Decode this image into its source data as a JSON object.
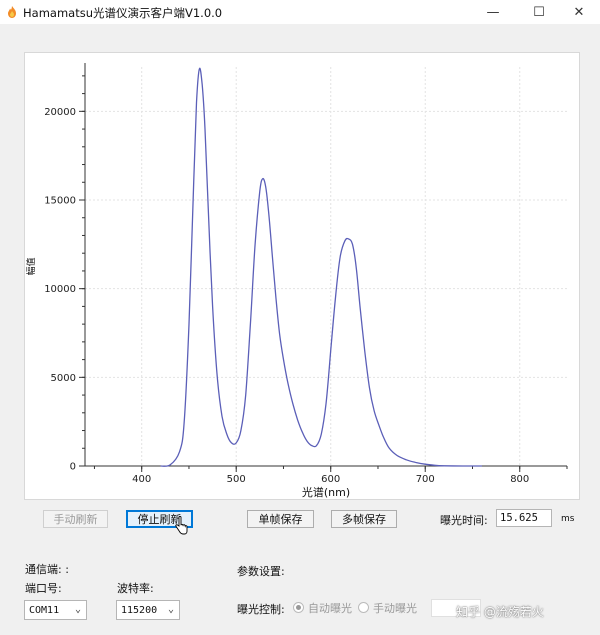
{
  "window": {
    "title": "Hamamatsu光谱仪演示客户端V1.0.0",
    "minimize_glyph": "—",
    "maximize_glyph": "☐",
    "close_glyph": "✕"
  },
  "chart_data": {
    "type": "line",
    "title": "",
    "xlabel": "光谱(nm)",
    "ylabel": "幅值",
    "xlim": [
      340,
      850
    ],
    "ylim": [
      0,
      22500
    ],
    "xticks": [
      400,
      500,
      600,
      700,
      800
    ],
    "yticks": [
      0,
      5000,
      10000,
      15000,
      20000
    ],
    "grid": true,
    "line_color": "#5b5fb8",
    "series": [
      {
        "x": [
          420,
          430,
          440,
          445,
          450,
          455,
          458,
          461,
          464,
          467,
          470,
          475,
          480,
          485,
          490,
          495,
          500,
          505,
          510,
          515,
          520,
          525,
          528,
          531,
          534,
          538,
          542,
          546,
          550,
          555,
          560,
          565,
          570,
          575,
          580,
          585,
          590,
          595,
          600,
          605,
          610,
          615,
          619,
          623,
          627,
          631,
          636,
          641,
          646,
          651,
          656,
          662,
          670,
          680,
          690,
          700,
          710,
          720,
          740,
          760
        ],
        "y": [
          0,
          60,
          800,
          2500,
          8000,
          16000,
          20500,
          22400,
          21500,
          19000,
          15000,
          9000,
          5000,
          2800,
          1800,
          1300,
          1300,
          2000,
          4000,
          8000,
          12500,
          15500,
          16200,
          15800,
          14500,
          12000,
          9500,
          7400,
          6000,
          4600,
          3500,
          2600,
          1900,
          1400,
          1150,
          1150,
          1800,
          3500,
          6500,
          9500,
          11800,
          12700,
          12800,
          12500,
          11200,
          9000,
          6500,
          4400,
          3100,
          2300,
          1600,
          1000,
          600,
          350,
          200,
          100,
          40,
          10,
          0,
          0
        ]
      }
    ]
  },
  "controls": {
    "manual_refresh_label": "手动刷新",
    "stop_refresh_label": "停止刷新",
    "single_frame_save_label": "单帧保存",
    "multi_frame_save_label": "多帧保存",
    "exposure_time_label": "曝光时间:",
    "exposure_time_value": "15.625",
    "exposure_time_unit": "ms"
  },
  "communication": {
    "status_label": "通信端: :",
    "port_label": "端口号:",
    "port_value": "COM11",
    "baud_label": "波特率:",
    "baud_value": "115200"
  },
  "parameters": {
    "section_label": "参数设置:",
    "exposure_control_label": "曝光控制:",
    "auto_exposure_label": "自动曝光",
    "manual_exposure_label": "手动曝光"
  },
  "watermark": "知乎 @流殇若火"
}
